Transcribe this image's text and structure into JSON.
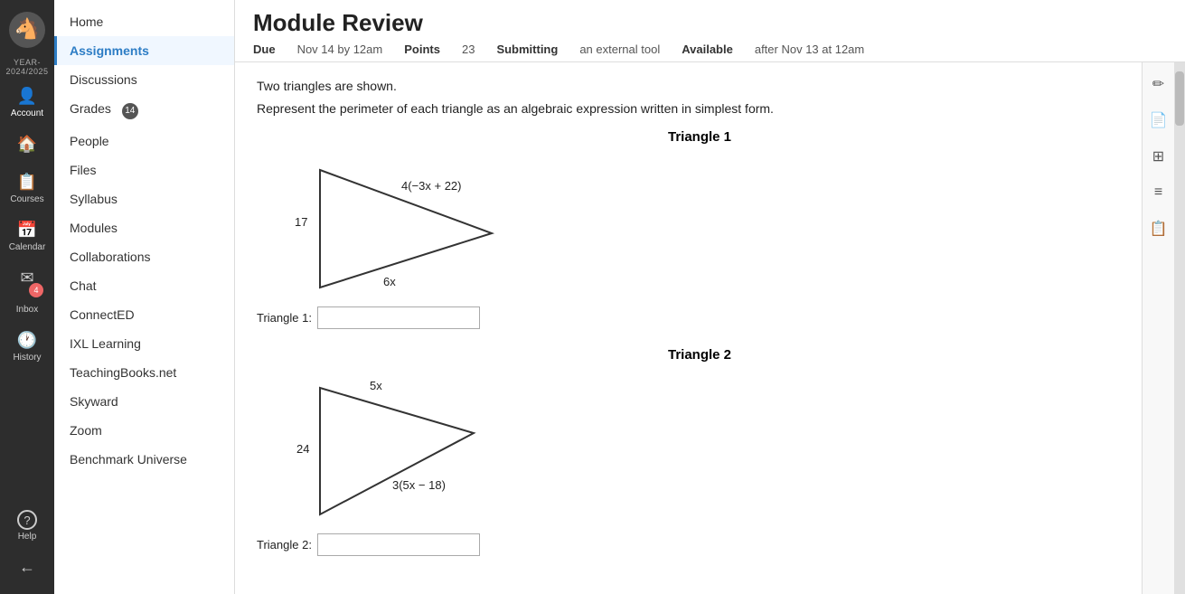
{
  "app": {
    "year_label": "YEAR-2024/2025"
  },
  "icon_sidebar": {
    "items": [
      {
        "id": "account",
        "label": "Account",
        "icon": "👤"
      },
      {
        "id": "dashboard",
        "label": "Dashboard",
        "icon": "🏠"
      },
      {
        "id": "courses",
        "label": "Courses",
        "icon": "📋"
      },
      {
        "id": "calendar",
        "label": "Calendar",
        "icon": "📅"
      },
      {
        "id": "inbox",
        "label": "Inbox",
        "icon": "✉",
        "badge": "4"
      },
      {
        "id": "history",
        "label": "History",
        "icon": "🕐"
      },
      {
        "id": "help",
        "label": "Help",
        "icon": "?"
      },
      {
        "id": "collapse",
        "label": "",
        "icon": "←"
      }
    ]
  },
  "nav_sidebar": {
    "items": [
      {
        "id": "home",
        "label": "Home",
        "active": false
      },
      {
        "id": "assignments",
        "label": "Assignments",
        "active": true
      },
      {
        "id": "discussions",
        "label": "Discussions",
        "active": false
      },
      {
        "id": "grades",
        "label": "Grades",
        "active": false,
        "badge": "14"
      },
      {
        "id": "people",
        "label": "People",
        "active": false
      },
      {
        "id": "files",
        "label": "Files",
        "active": false
      },
      {
        "id": "syllabus",
        "label": "Syllabus",
        "active": false
      },
      {
        "id": "modules",
        "label": "Modules",
        "active": false
      },
      {
        "id": "collaborations",
        "label": "Collaborations",
        "active": false
      },
      {
        "id": "chat",
        "label": "Chat",
        "active": false
      },
      {
        "id": "connected",
        "label": "ConnectED",
        "active": false
      },
      {
        "id": "ixl",
        "label": "IXL Learning",
        "active": false
      },
      {
        "id": "teachingbooks",
        "label": "TeachingBooks.net",
        "active": false
      },
      {
        "id": "skyward",
        "label": "Skyward",
        "active": false
      },
      {
        "id": "zoom",
        "label": "Zoom",
        "active": false
      },
      {
        "id": "benchmark",
        "label": "Benchmark Universe",
        "active": false
      }
    ]
  },
  "page": {
    "title": "Module Review",
    "due_label": "Due",
    "due_value": "Nov 14 by 12am",
    "points_label": "Points",
    "points_value": "23",
    "submitting_label": "Submitting",
    "submitting_value": "an external tool",
    "available_label": "Available",
    "available_value": "after Nov 13 at 12am"
  },
  "question": {
    "line1": "Two triangles are shown.",
    "line2": "Represent the perimeter of each triangle as an algebraic expression written in simplest form.",
    "triangle1_title": "Triangle 1",
    "triangle1_side1": "17",
    "triangle1_side2": "4(−3x + 22)",
    "triangle1_side3": "6x",
    "triangle1_answer_label": "Triangle 1:",
    "triangle1_answer_placeholder": "",
    "triangle2_title": "Triangle 2",
    "triangle2_side1": "5x",
    "triangle2_side2": "24",
    "triangle2_side3": "3(5x − 18)",
    "triangle2_answer_label": "Triangle 2:",
    "triangle2_answer_placeholder": ""
  },
  "right_tools": {
    "tool1": "✏",
    "tool2": "📄",
    "tool3": "📊",
    "tool4": "≡",
    "tool5": "📋"
  }
}
